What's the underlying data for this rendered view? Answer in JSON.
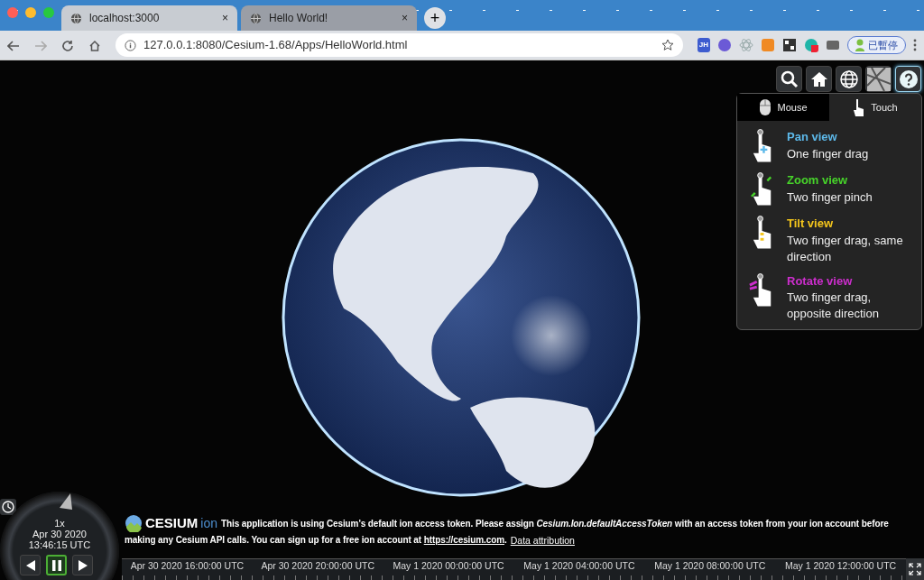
{
  "browser": {
    "tabs": [
      {
        "title": "localhost:3000",
        "selected": true,
        "close": "×"
      },
      {
        "title": "Hello World!",
        "selected": false,
        "close": "×"
      }
    ],
    "new_tab": "+",
    "address": "127.0.0.1:8080/Cesium-1.68/Apps/HelloWorld.html",
    "extension_label": "JH",
    "profile_button": "已暫停"
  },
  "toolbar": {
    "help_open": true
  },
  "help_panel": {
    "tabs": [
      {
        "label": "Mouse",
        "kind": "mouse",
        "selected": false
      },
      {
        "label": "Touch",
        "kind": "touch",
        "selected": true
      }
    ],
    "items": [
      {
        "kind": "pan",
        "title": "Pan view",
        "description": "One finger drag",
        "color": "#5db9ea"
      },
      {
        "kind": "zoom",
        "title": "Zoom view",
        "description": "Two finger pinch",
        "color": "#47d42a"
      },
      {
        "kind": "tilt",
        "title": "Tilt view",
        "description": "Two finger drag, same direction",
        "color": "#f4c61c"
      },
      {
        "kind": "rotate",
        "title": "Rotate view",
        "description": "Two finger drag, opposite direction",
        "color": "#cc2ecc"
      }
    ]
  },
  "animation": {
    "speed": "1x",
    "date": "Apr 30 2020",
    "time": "13:46:15 UTC",
    "buttons": [
      {
        "kind": "reverse",
        "selected": false
      },
      {
        "kind": "pause",
        "selected": true
      },
      {
        "kind": "play",
        "selected": false
      }
    ]
  },
  "credits": {
    "logo_word": "CESIUM",
    "logo_suffix": "ion",
    "message": "This application is using Cesium's default ion access token. Please assign *Cesium.Ion.defaultAccessToken* with an access token from your ion account before",
    "message_continued": "making any Cesium API calls. You can sign up for a free ion account at",
    "link": "https://cesium.com",
    "after_link": ".",
    "attribution": "Data attribution"
  },
  "timeline": {
    "labels": [
      "Apr 30 2020 16:00:00 UTC",
      "Apr 30 2020 20:00:00 UTC",
      "May 1 2020 00:00:00 UTC",
      "May 1 2020 04:00:00 UTC",
      "May 1 2020 08:00:00 UTC",
      "May 1 2020 12:00:00 UTC"
    ]
  }
}
